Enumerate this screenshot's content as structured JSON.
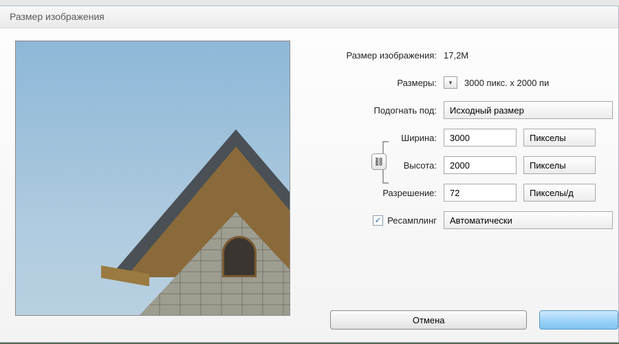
{
  "title": "Размер изображения",
  "image_size": {
    "label": "Размер изображения:",
    "value": "17,2M"
  },
  "dimensions": {
    "label": "Размеры:",
    "value": "3000 пикс. x 2000 пи"
  },
  "fit_to": {
    "label": "Подогнать под:",
    "value": "Исходный размер"
  },
  "width": {
    "label": "Ширина:",
    "value": "3000",
    "unit": "Пикселы"
  },
  "height": {
    "label": "Высота:",
    "value": "2000",
    "unit": "Пикселы"
  },
  "resolution": {
    "label": "Разрешение:",
    "value": "72",
    "unit": "Пикселы/д"
  },
  "resample": {
    "label": "Ресамплинг",
    "checked": true,
    "mode": "Автоматически"
  },
  "buttons": {
    "cancel": "Отмена"
  }
}
